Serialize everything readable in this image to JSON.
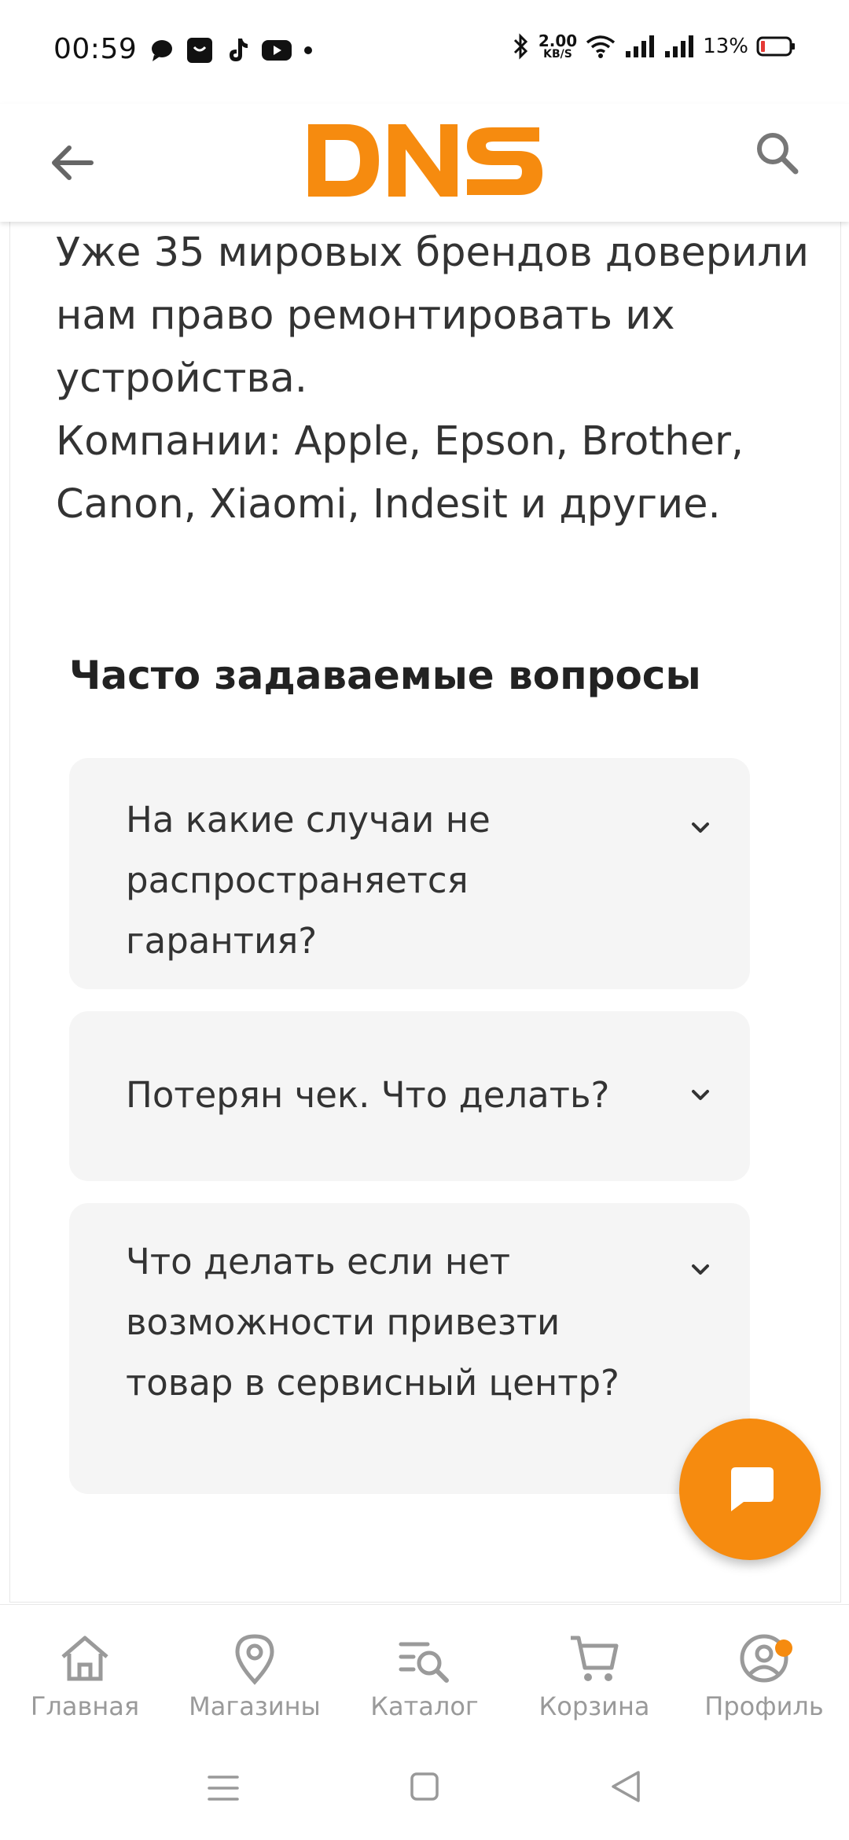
{
  "status_bar": {
    "time": "00:59",
    "net_speed_value": "2.00",
    "net_speed_unit": "KB/S",
    "battery_percent": "13%"
  },
  "header": {
    "logo_text": "DNS",
    "brand_color": "#f68b0f"
  },
  "intro": {
    "paragraph_1": "Уже 35 мировых брендов доверили нам право ремонтировать их устройства.",
    "paragraph_2": "Компании: Apple, Epson, Brother, Canon, Xiaomi, Indesit и другие."
  },
  "faq": {
    "title": "Часто задаваемые вопросы",
    "items": [
      {
        "question": "На какие случаи не распространяется гарантия?"
      },
      {
        "question": "Потерян чек. Что делать?"
      },
      {
        "question": "Что делать если нет возможности привезти товар в сервисный центр?"
      }
    ]
  },
  "bottom_nav": {
    "items": [
      {
        "label": "Главная",
        "icon": "home-icon"
      },
      {
        "label": "Магазины",
        "icon": "map-pin-icon"
      },
      {
        "label": "Каталог",
        "icon": "catalog-search-icon"
      },
      {
        "label": "Корзина",
        "icon": "cart-icon"
      },
      {
        "label": "Профиль",
        "icon": "profile-icon"
      }
    ]
  },
  "colors": {
    "accent": "#f68b0f",
    "nav_inactive": "#9a9a9a",
    "faq_bg": "#f5f5f5"
  }
}
